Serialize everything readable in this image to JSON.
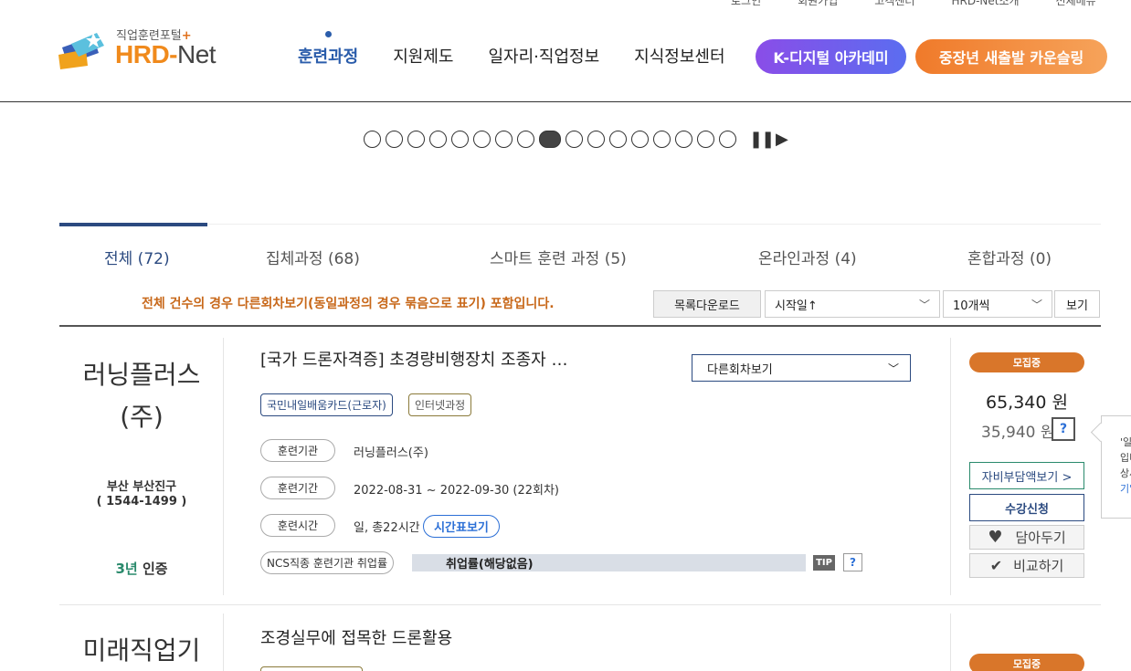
{
  "header": {
    "util_links": [
      "로그인",
      "회원가입",
      "고객센터",
      "HRD-Net소개",
      "전체메뉴"
    ],
    "logo": {
      "sub": "직업훈련포털",
      "plus": "+",
      "main_a": "HRD-",
      "main_b": "Net"
    },
    "nav": [
      "훈련과정",
      "지원제도",
      "일자리·직업정보",
      "지식정보센터"
    ],
    "pill_k": "K-디지털 아카데미",
    "pill_mid": "중장년 새출발 카운슬링"
  },
  "slider": {
    "count": 17,
    "active_index": 8,
    "pause_icon": "pause-icon",
    "play_icon": "play-icon"
  },
  "tabs": [
    {
      "label": "전체 (72)",
      "active": true
    },
    {
      "label": "집체과정 (68)",
      "active": false
    },
    {
      "label": "스마트 훈련 과정 (5)",
      "active": false
    },
    {
      "label": "온라인과정 (4)",
      "active": false
    },
    {
      "label": "혼합과정 (0)",
      "active": false
    }
  ],
  "toolbar": {
    "notice": "전체 건수의 경우 다른회차보기(동일과정의 경우 묶음으로 표기) 포함입니다.",
    "download": "목록다운로드",
    "sort": "시작일↑",
    "page_size": "10개씩",
    "view": "보기"
  },
  "courses": [
    {
      "org_name_1": "러닝플러스",
      "org_name_2": "(주)",
      "org_loc": "부산 부산진구",
      "org_tel": "( 1544-1499 )",
      "cert_year": "3년",
      "cert_label": "인증",
      "title": "[국가 드론자격증] 초경량비행장치 조종자 …",
      "round_select": "다른회차보기",
      "tags": [
        "국민내일배움카드(근로자)",
        "인터넷과정"
      ],
      "info": [
        {
          "label": "훈련기관",
          "value": "러닝플러스(주)"
        },
        {
          "label": "훈련기간",
          "value": "2022-08-31 ~ 2022-09-30 (22회차)"
        },
        {
          "label": "훈련시간",
          "value": "일, 총22시간"
        }
      ],
      "time_table_btn": "시간표보기",
      "ncs_label": "NCS직종 훈련기관 취업률",
      "employment": "취업률(해당없음)",
      "tip": "TIP",
      "help": "?",
      "status": "모집중",
      "price": "65,340 원",
      "price_self": "35,940 원",
      "btn_self_pay": "자비부담액보기 >",
      "btn_apply": "수강신청",
      "btn_wish": "담아두기",
      "btn_compare": "비교하기",
      "popover_lines": [
        "'일",
        "입비",
        "상세",
        "기'"
      ]
    },
    {
      "org_name_1": "미래직업기",
      "title": "조경실무에 접목한 드론활용",
      "status": "모집중"
    }
  ]
}
